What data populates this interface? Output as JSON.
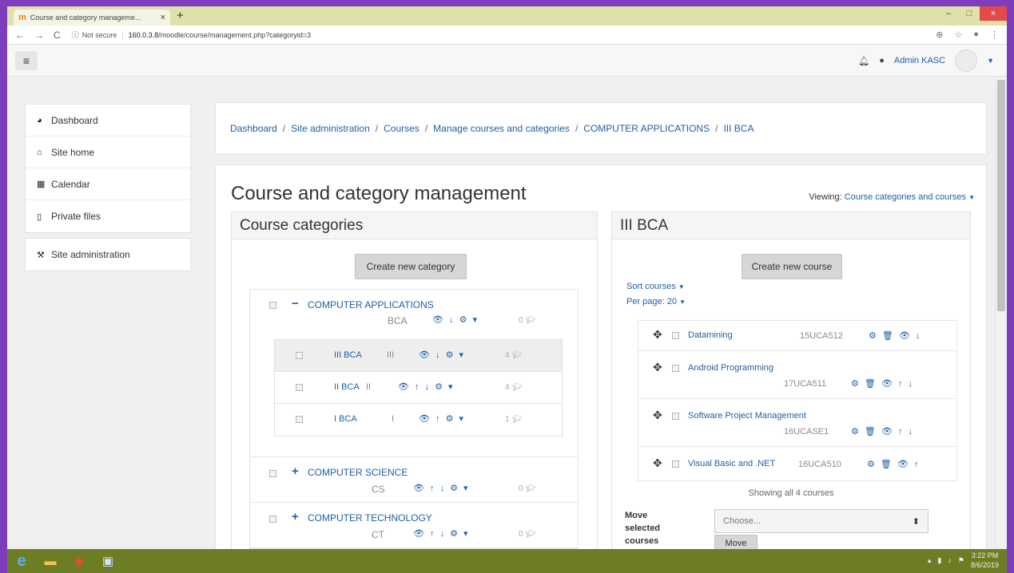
{
  "browser": {
    "tab_title": "Course and category manageme...",
    "tab_close": "×",
    "new_tab": "+",
    "window_controls": {
      "minimize": "–",
      "maximize": "□",
      "close": "×"
    },
    "security": "Not secure",
    "url_host": "160.0.3.8",
    "url_path": "/moodle/course/management.php?categoryid=3"
  },
  "navbar": {
    "menu_icon": "hamburger-icon",
    "user_name": "Admin KASC",
    "notification_icon": "bell-icon",
    "message_icon": "chat-icon"
  },
  "sidebar": {
    "group1": [
      {
        "label": "Dashboard",
        "icon": "dashboard-icon"
      },
      {
        "label": "Site home",
        "icon": "home-icon"
      },
      {
        "label": "Calendar",
        "icon": "calendar-icon"
      },
      {
        "label": "Private files",
        "icon": "file-icon"
      }
    ],
    "group2": [
      {
        "label": "Site administration",
        "icon": "wrench-icon"
      }
    ]
  },
  "breadcrumb": [
    "Dashboard",
    "Site administration",
    "Courses",
    "Manage courses and categories",
    "COMPUTER APPLICATIONS",
    "III BCA"
  ],
  "breadcrumb_sep": "/",
  "page": {
    "title": "Course and category management",
    "viewing_label": "Viewing:",
    "viewing_value": "Course categories and courses"
  },
  "categories_panel": {
    "heading": "Course categories",
    "create_button": "Create new category",
    "categories": [
      {
        "name": "COMPUTER APPLICATIONS",
        "idnumber": "BCA",
        "count": "0",
        "expanded": true,
        "toggle": "−",
        "subcategories": [
          {
            "name": "III BCA",
            "idnumber": "III",
            "count": "4",
            "selected": true
          },
          {
            "name": "II BCA",
            "idnumber": "II",
            "count": "4",
            "selected": false
          },
          {
            "name": "I BCA",
            "idnumber": "I",
            "count": "1",
            "selected": false
          }
        ]
      },
      {
        "name": "COMPUTER SCIENCE",
        "idnumber": "CS",
        "count": "0",
        "expanded": false,
        "toggle": "+"
      },
      {
        "name": "COMPUTER TECHNOLOGY",
        "idnumber": "CT",
        "count": "0",
        "expanded": false,
        "toggle": "+"
      }
    ]
  },
  "courses_panel": {
    "heading": "III BCA",
    "create_button": "Create new course",
    "sort_label": "Sort courses",
    "per_page_label": "Per page: 20",
    "courses": [
      {
        "name": "Datamining",
        "code": "15UCA512"
      },
      {
        "name": "Android Programming",
        "code": "17UCA511"
      },
      {
        "name": "Software Project Management",
        "code": "16UCASE1"
      },
      {
        "name": "Visual Basic and .NET",
        "code": "16UCA510"
      }
    ],
    "showing": "Showing all 4 courses",
    "move_label": "Move selected courses",
    "move_select": "Choose...",
    "move_button": "Move"
  },
  "taskbar": {
    "time": "3:22 PM",
    "date": "8/6/2019"
  },
  "colors": {
    "link": "#1f5fa8",
    "frame": "#7d3dbd",
    "taskbar": "#6d7d23"
  }
}
